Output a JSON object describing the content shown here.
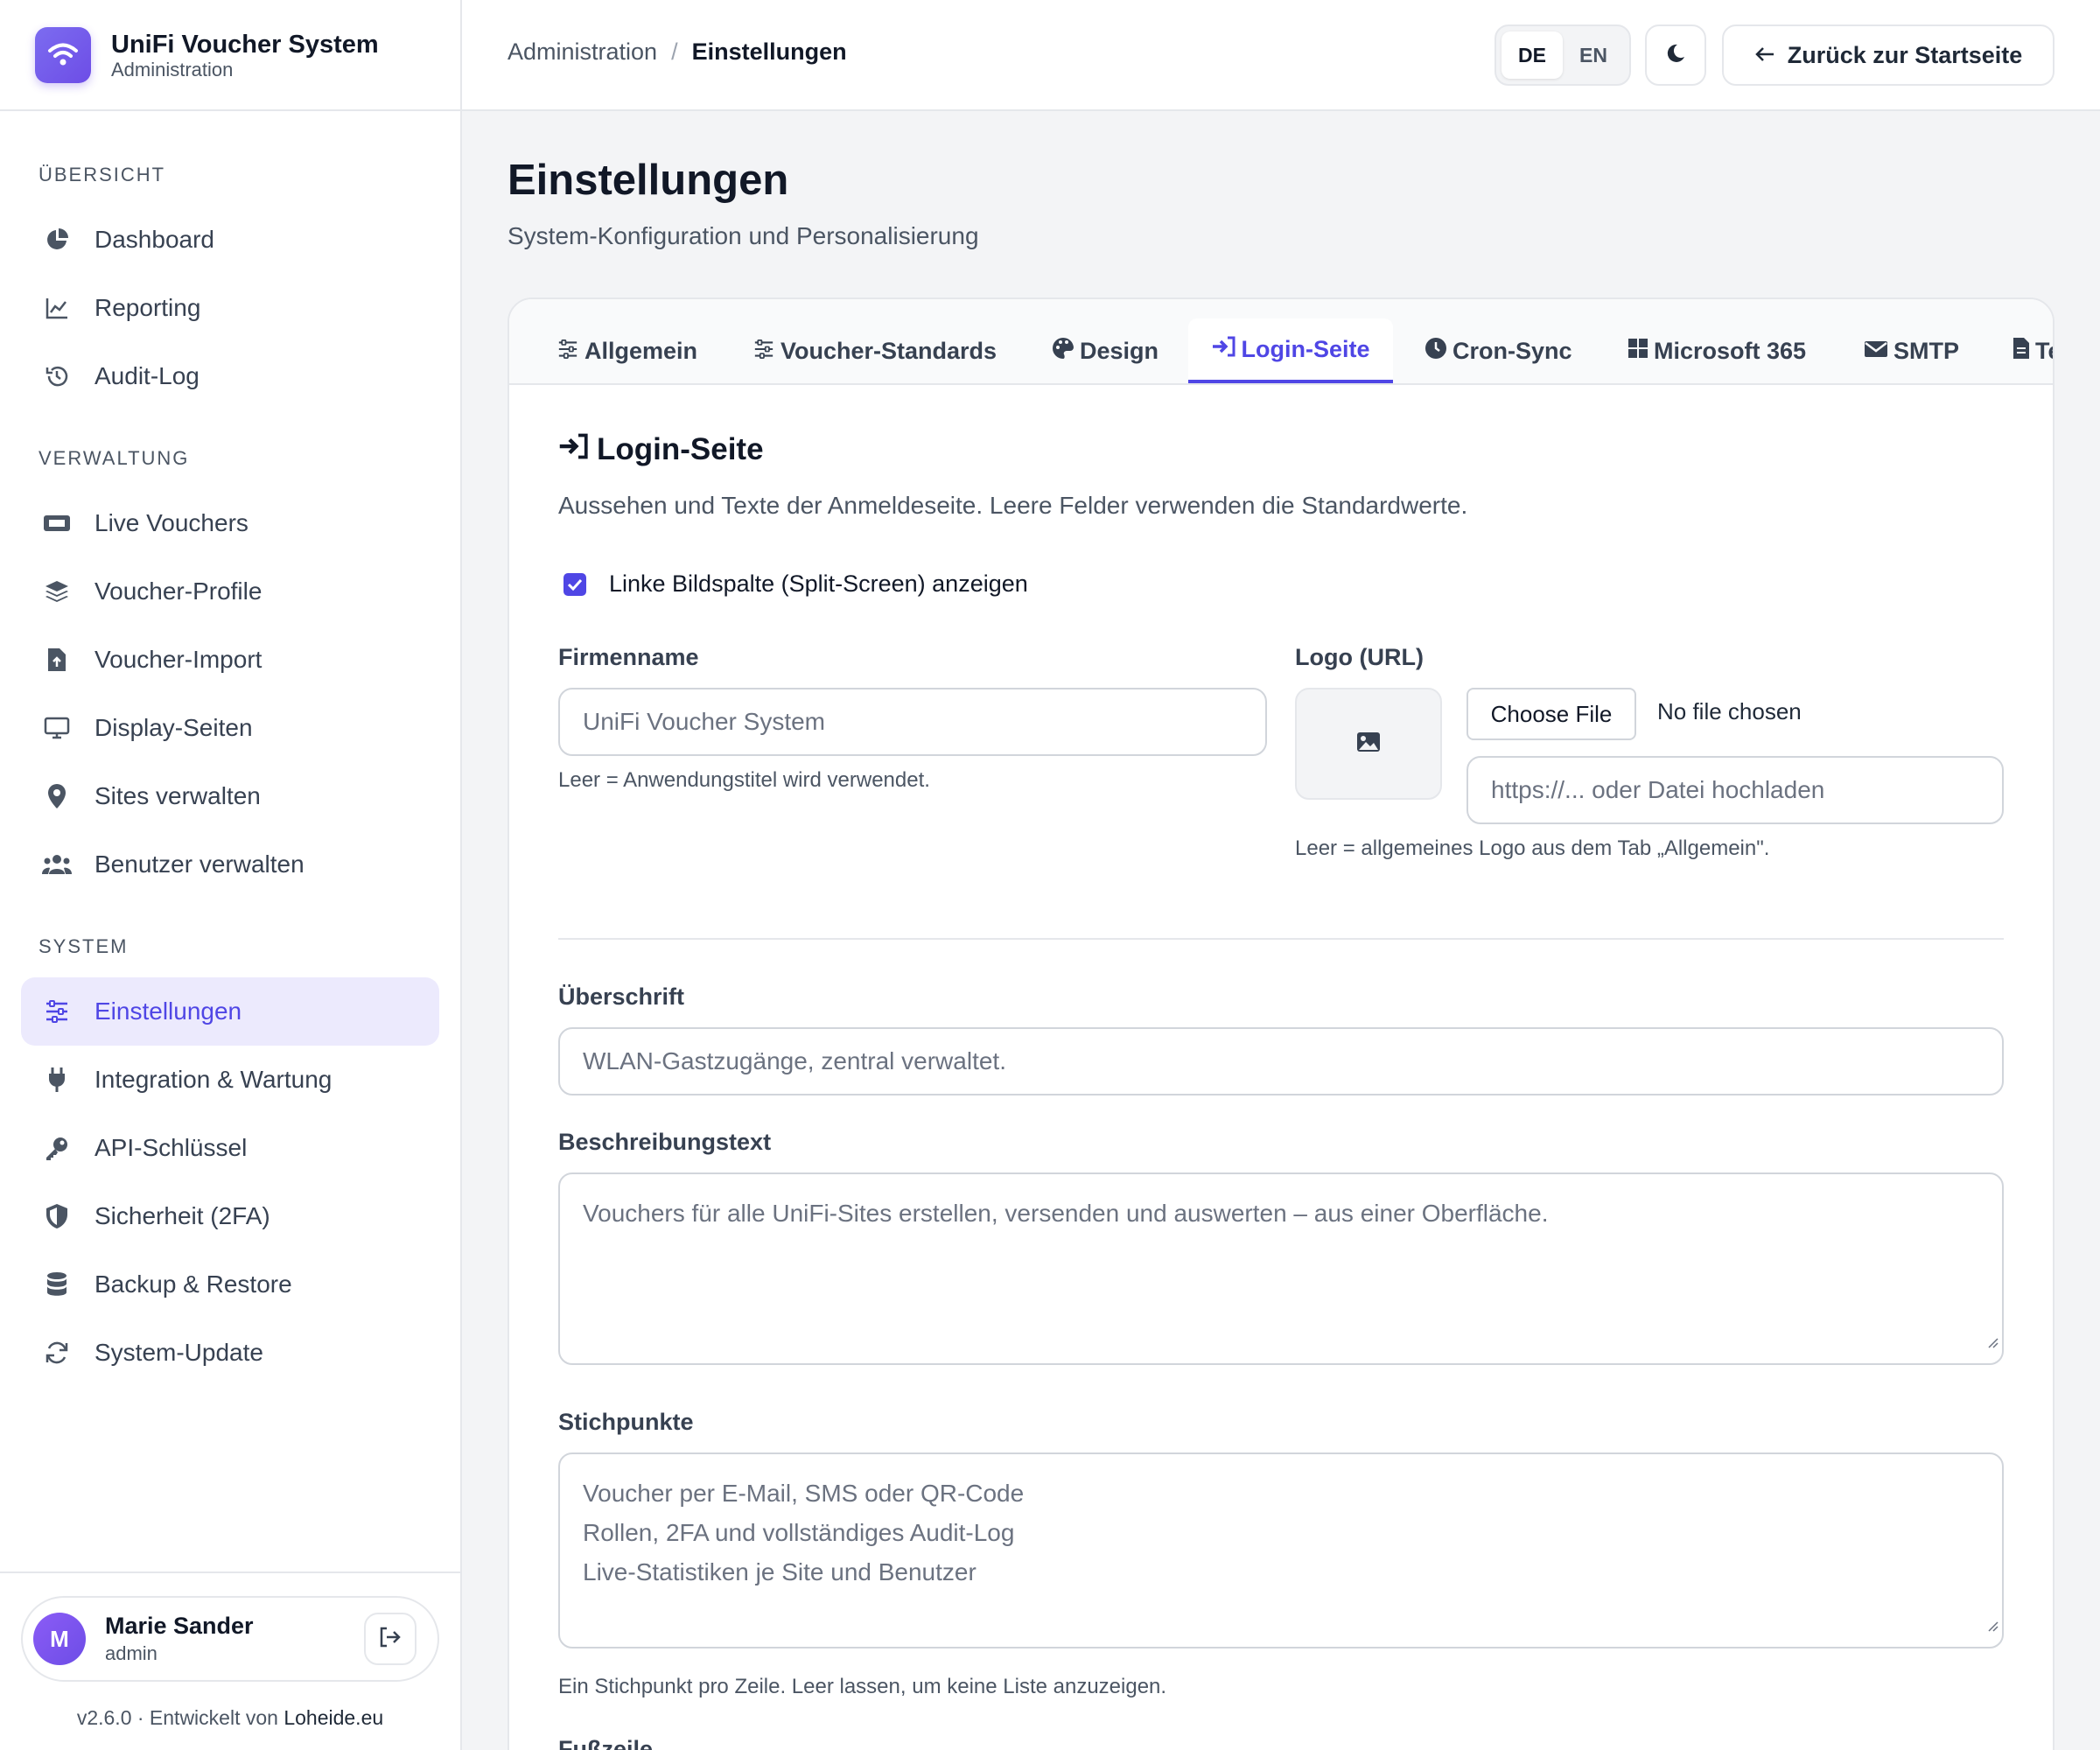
{
  "brand": {
    "title": "UniFi Voucher System",
    "subtitle": "Administration"
  },
  "sidebar": {
    "sections": [
      {
        "title": "ÜBERSICHT",
        "items": [
          {
            "label": "Dashboard",
            "icon": "pie-chart-icon"
          },
          {
            "label": "Reporting",
            "icon": "line-chart-icon"
          },
          {
            "label": "Audit-Log",
            "icon": "history-icon"
          }
        ]
      },
      {
        "title": "VERWALTUNG",
        "items": [
          {
            "label": "Live Vouchers",
            "icon": "ticket-icon"
          },
          {
            "label": "Voucher-Profile",
            "icon": "layers-icon"
          },
          {
            "label": "Voucher-Import",
            "icon": "file-upload-icon"
          },
          {
            "label": "Display-Seiten",
            "icon": "monitor-icon"
          },
          {
            "label": "Sites verwalten",
            "icon": "map-pin-icon"
          },
          {
            "label": "Benutzer verwalten",
            "icon": "users-icon"
          }
        ]
      },
      {
        "title": "SYSTEM",
        "items": [
          {
            "label": "Einstellungen",
            "icon": "sliders-icon",
            "active": true
          },
          {
            "label": "Integration & Wartung",
            "icon": "plug-icon"
          },
          {
            "label": "API-Schlüssel",
            "icon": "key-icon"
          },
          {
            "label": "Sicherheit (2FA)",
            "icon": "shield-icon"
          },
          {
            "label": "Backup & Restore",
            "icon": "database-icon"
          },
          {
            "label": "System-Update",
            "icon": "refresh-icon"
          }
        ]
      }
    ],
    "user": {
      "initial": "M",
      "name": "Marie Sander",
      "role": "admin"
    },
    "version": "v2.6.0 · Entwickelt von",
    "developer": "Loheide.eu"
  },
  "header": {
    "breadcrumb": {
      "parent": "Administration",
      "separator": "/",
      "current": "Einstellungen"
    },
    "languages": [
      "DE",
      "EN"
    ],
    "active_language": "DE",
    "back_label": "Zurück zur Startseite"
  },
  "page": {
    "title": "Einstellungen",
    "subtitle": "System-Konfiguration und Personalisierung"
  },
  "tabs": [
    {
      "label": "Allgemein",
      "icon": "sliders-icon"
    },
    {
      "label": "Voucher-Standards",
      "icon": "sliders-icon"
    },
    {
      "label": "Design",
      "icon": "palette-icon"
    },
    {
      "label": "Login-Seite",
      "icon": "sign-in-icon",
      "active": true
    },
    {
      "label": "Cron-Sync",
      "icon": "clock-icon"
    },
    {
      "label": "Microsoft 365",
      "icon": "windows-icon"
    },
    {
      "label": "SMTP",
      "icon": "envelope-icon"
    },
    {
      "label": "Te",
      "icon": "file-icon"
    }
  ],
  "login": {
    "title": "Login-Seite",
    "description": "Aussehen und Texte der Anmeldeseite. Leere Felder verwenden die Standardwerte.",
    "split_screen_label": "Linke Bildspalte (Split-Screen) anzeigen",
    "split_screen_checked": true,
    "company_label": "Firmenname",
    "company_placeholder": "UniFi Voucher System",
    "company_hint": "Leer = Anwendungstitel wird verwendet.",
    "logo_label": "Logo (URL)",
    "choose_file": "Choose File",
    "no_file": "No file chosen",
    "logo_placeholder": "https://... oder Datei hochladen",
    "logo_hint": "Leer = allgemeines Logo aus dem Tab „Allgemein\".",
    "heading_label": "Überschrift",
    "heading_placeholder": "WLAN-Gastzugänge, zentral verwaltet.",
    "description_label": "Beschreibungstext",
    "description_placeholder": "Vouchers für alle UniFi-Sites erstellen, versenden und auswerten – aus einer Oberfläche.",
    "bullets_label": "Stichpunkte",
    "bullets": [
      "Voucher per E-Mail, SMS oder QR-Code",
      "Rollen, 2FA und vollständiges Audit-Log",
      "Live-Statistiken je Site und Benutzer"
    ],
    "bullets_hint": "Ein Stichpunkt pro Zeile. Leer lassen, um keine Liste anzuzeigen.",
    "footer_label": "Fußzeile"
  },
  "colors": {
    "accent": "#4f46e5",
    "active_bg": "#eceafd",
    "brand_gradient": "#6d4de6"
  }
}
